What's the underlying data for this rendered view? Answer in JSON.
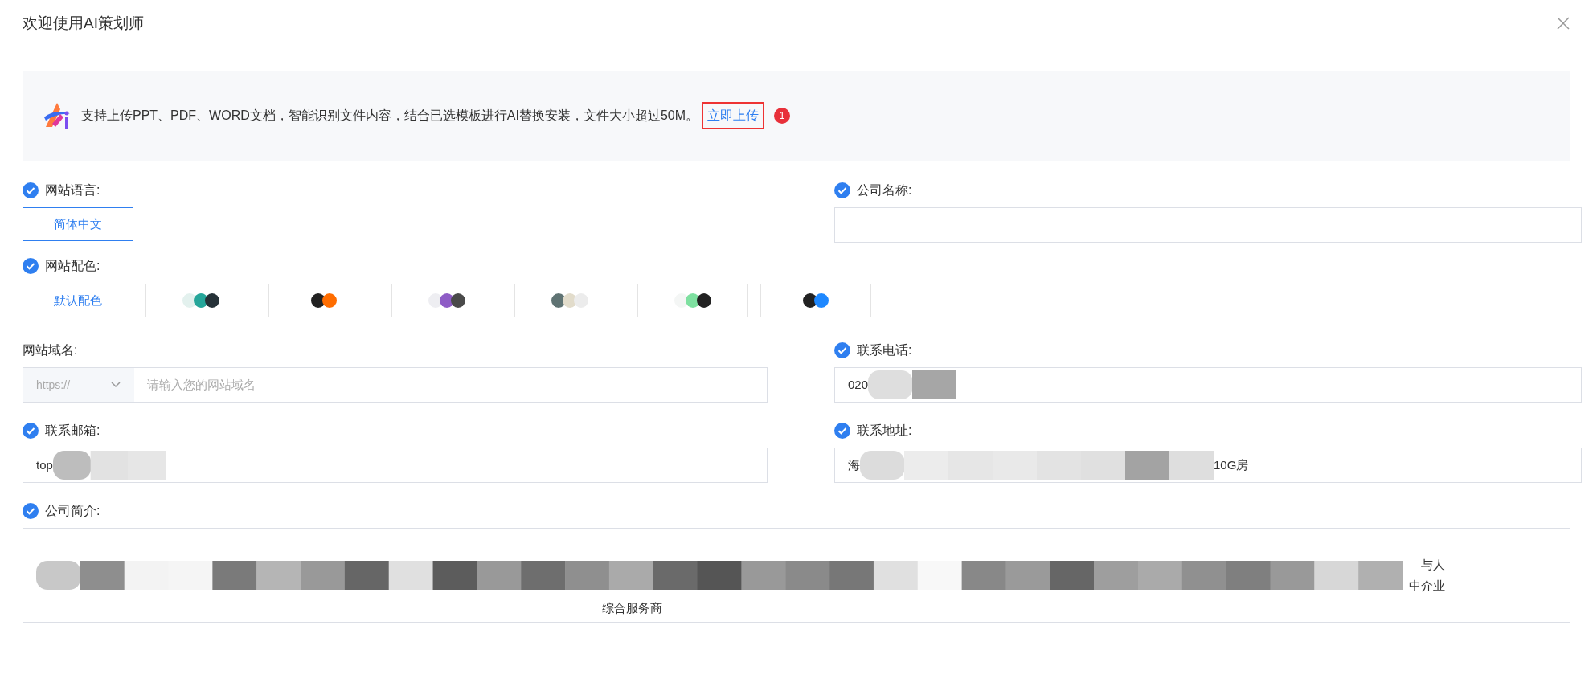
{
  "window": {
    "title": "欢迎使用AI策划师"
  },
  "banner": {
    "text": "支持上传PPT、PDF、WORD文档，智能识别文件内容，结合已选模板进行AI替换安装，文件大小超过50M。",
    "link": "立即上传",
    "badge": "1"
  },
  "language": {
    "label": "网站语言:",
    "checked": true,
    "options": [
      {
        "label": "简体中文",
        "selected": true
      }
    ]
  },
  "palette": {
    "label": "网站配色:",
    "checked": true,
    "options": [
      {
        "kind": "text",
        "label": "默认配色",
        "selected": true
      },
      {
        "kind": "dots",
        "dots": [
          {
            "color": "#e3f1ee"
          },
          {
            "color": "#26a69a"
          },
          {
            "color": "#263238"
          }
        ],
        "selected": false
      },
      {
        "kind": "dots",
        "dots": [
          {
            "color": "#222222"
          },
          {
            "color": "#ff6d00"
          }
        ],
        "selected": false
      },
      {
        "kind": "dots",
        "dots": [
          {
            "color": "#eeeef2"
          },
          {
            "color": "#8e5cc6"
          },
          {
            "color": "#4a4a4a"
          }
        ],
        "selected": false
      },
      {
        "kind": "dots",
        "dots": [
          {
            "color": "#5f7373"
          },
          {
            "color": "#e2dccb"
          },
          {
            "color": "#ececec"
          }
        ],
        "selected": false
      },
      {
        "kind": "dots",
        "dots": [
          {
            "color": "#f4f6f5"
          },
          {
            "color": "#7ee0a0"
          },
          {
            "color": "#222222"
          }
        ],
        "selected": false
      },
      {
        "kind": "dots",
        "dots": [
          {
            "color": "#222222"
          },
          {
            "color": "#1e88ff"
          }
        ],
        "selected": false
      }
    ]
  },
  "domain": {
    "label": "网站域名:",
    "protocol": "https://",
    "placeholder": "请输入您的网站域名"
  },
  "email": {
    "label": "联系邮箱:",
    "checked": true,
    "value": "top"
  },
  "company_name": {
    "label": "公司名称:",
    "checked": true
  },
  "phone": {
    "label": "联系电话:",
    "checked": true,
    "value": "020"
  },
  "address": {
    "label": "联系地址:",
    "checked": true,
    "value": "海",
    "value_end": "10G房"
  },
  "intro": {
    "label": "公司简介:",
    "checked": true,
    "fragments": [
      "与人",
      "中介业",
      "综合服务商"
    ]
  }
}
